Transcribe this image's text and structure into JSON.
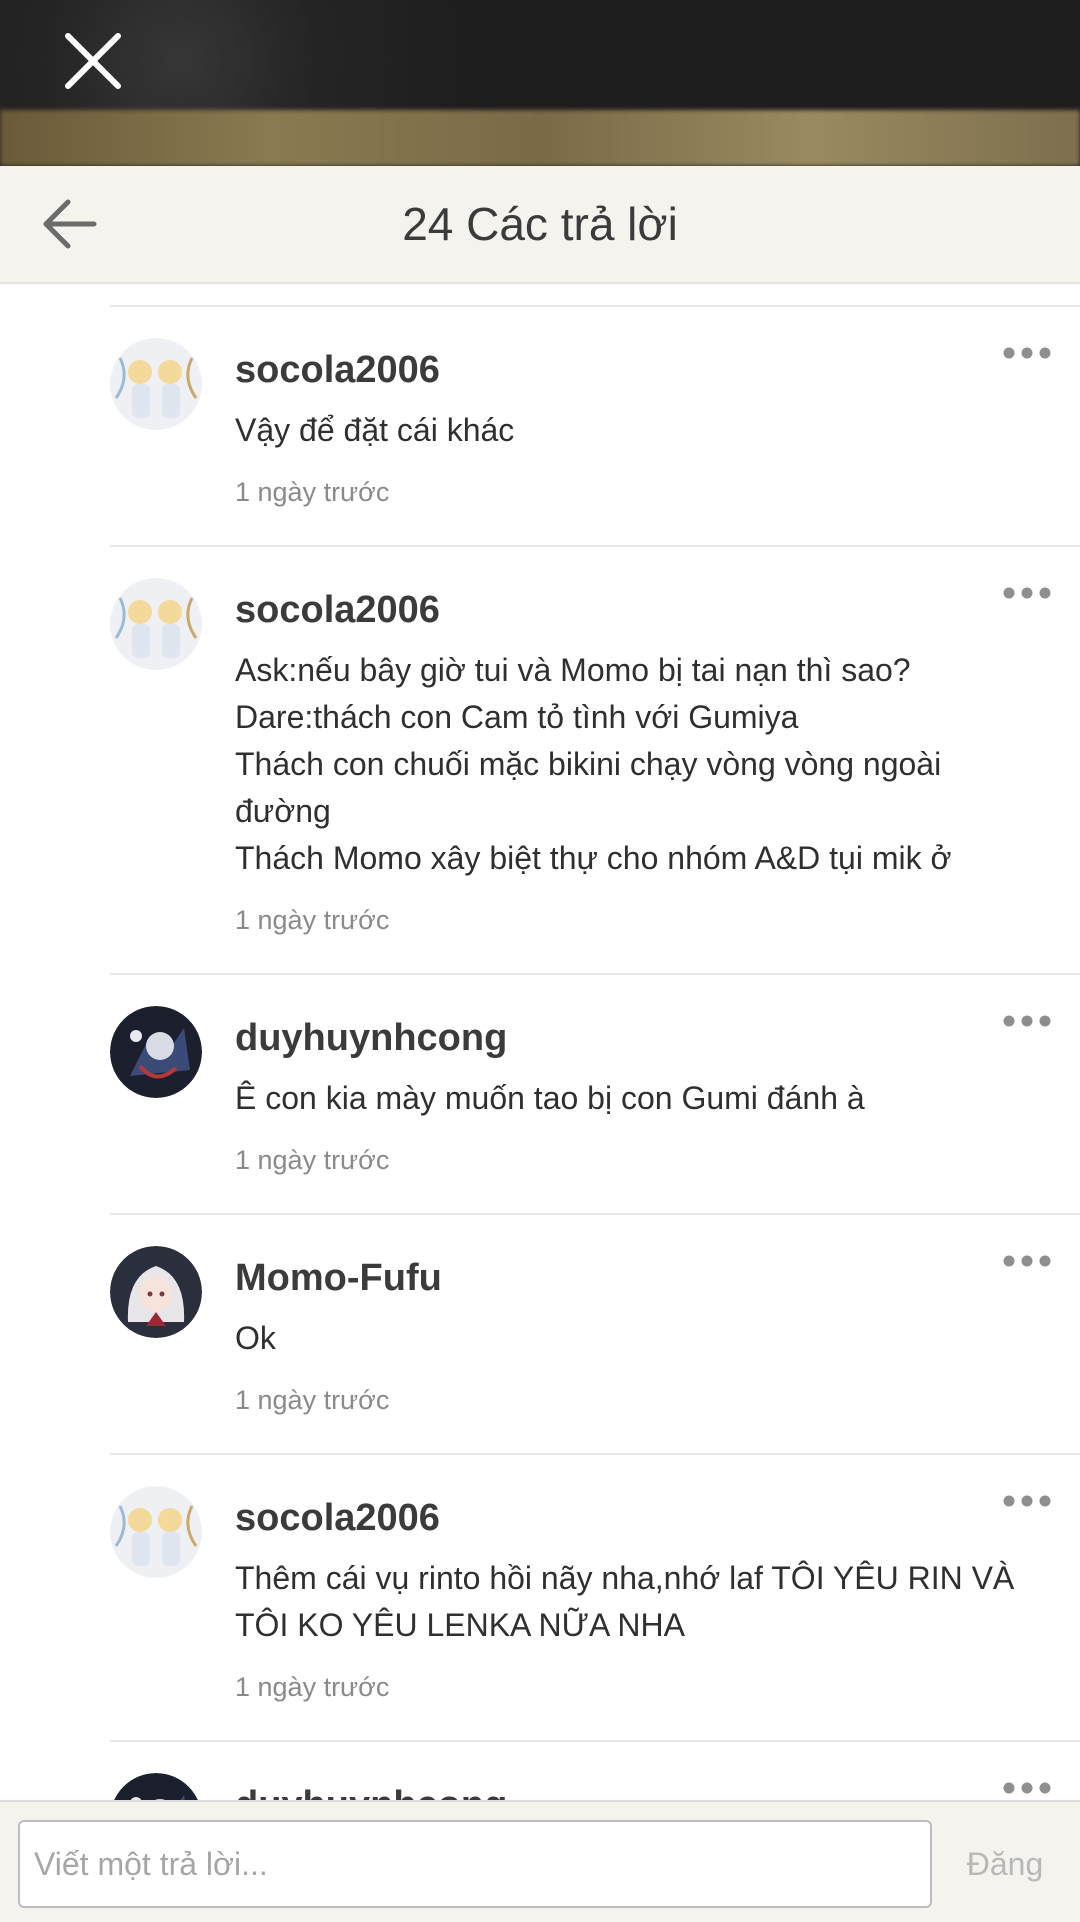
{
  "header": {
    "title": "24 Các trả lời"
  },
  "replies": [
    {
      "username": "socola2006",
      "lines": [
        "Vậy để đặt cái khác"
      ],
      "time": "1 ngày trước",
      "avatar": "anime-twins-avatar"
    },
    {
      "username": "socola2006",
      "lines": [
        "Ask:nếu bây giờ tui và Momo bị tai nạn thì sao?",
        "Dare:thách con Cam tỏ tình với Gumiya",
        "Thách con chuối mặc bikini chạy vòng vòng ngoài",
        "đường",
        "Thách Momo xây biệt thự cho nhóm A&D tụi mik ở"
      ],
      "time": "1 ngày trước",
      "avatar": "anime-twins-avatar"
    },
    {
      "username": "duyhuynhcong",
      "lines": [
        "Ê con kia mày muốn tao bị con Gumi đánh à"
      ],
      "time": "1 ngày trước",
      "avatar": "dark-anime-avatar"
    },
    {
      "username": "Momo-Fufu",
      "lines": [
        "Ok"
      ],
      "time": "1 ngày trước",
      "avatar": "white-hair-girl-avatar"
    },
    {
      "username": "socola2006",
      "lines": [
        "Thêm cái vụ rinto hồi nãy nha,nhớ laf TÔI YÊU RIN VÀ",
        "TÔI KO YÊU LENKA NỮA NHA"
      ],
      "time": "1 ngày trước",
      "avatar": "anime-twins-avatar"
    },
    {
      "username": "duyhuynhcong",
      "lines": [],
      "time": "",
      "avatar": "dark-anime-avatar"
    }
  ],
  "composer": {
    "placeholder": "Viết một trả lời...",
    "post_label": "Đăng"
  },
  "icons": {
    "close": "close-icon",
    "back": "back-arrow-icon",
    "more": "more-options-icon"
  },
  "colors": {
    "header_bg": "#f4f3ee",
    "overlay_bg": "#1e1e1e",
    "text": "#3b3b3b",
    "meta": "#8a8a8a"
  }
}
